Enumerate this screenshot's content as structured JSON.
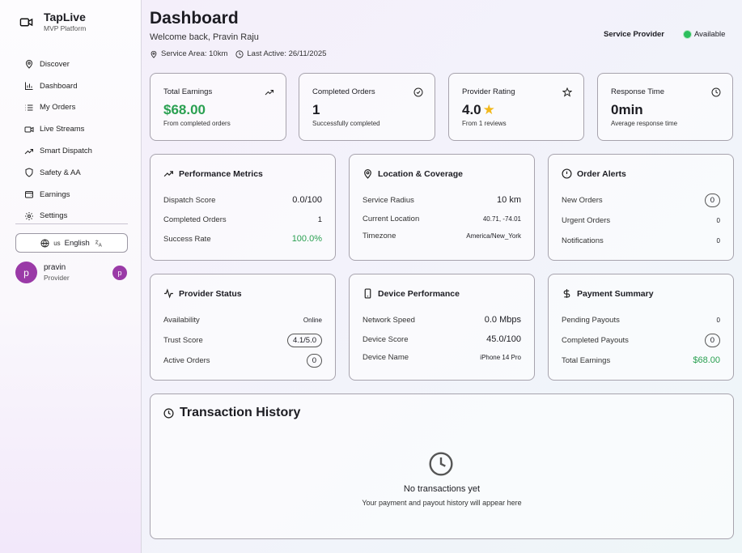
{
  "brand": {
    "name": "TapLive",
    "subtitle": "MVP Platform"
  },
  "nav": [
    {
      "label": "Discover",
      "icon": "map-pin-icon"
    },
    {
      "label": "Dashboard",
      "icon": "bar-chart-icon"
    },
    {
      "label": "My Orders",
      "icon": "list-icon"
    },
    {
      "label": "Live Streams",
      "icon": "video-icon"
    },
    {
      "label": "Smart Dispatch",
      "icon": "trending-up-icon"
    },
    {
      "label": "Safety & AA",
      "icon": "shield-icon"
    },
    {
      "label": "Earnings",
      "icon": "wallet-icon"
    },
    {
      "label": "Settings",
      "icon": "gear-icon"
    }
  ],
  "language": {
    "flag": "us",
    "label": "English"
  },
  "user": {
    "initial": "p",
    "name": "pravin",
    "role": "Provider"
  },
  "header": {
    "title": "Dashboard",
    "welcome": "Welcome back, Pravin Raju",
    "service_area": "Service Area: 10km",
    "last_active": "Last Active: 26/11/2025",
    "role_label": "Service Provider",
    "availability": "Available"
  },
  "stats": [
    {
      "title": "Total Earnings",
      "value": "$68.00",
      "sub": "From completed orders",
      "icon": "trending-up-icon"
    },
    {
      "title": "Completed Orders",
      "value": "1",
      "sub": "Successfully completed",
      "icon": "check-circle-icon"
    },
    {
      "title": "Provider Rating",
      "value": "4.0",
      "sub": "From 1 reviews",
      "icon": "star-icon"
    },
    {
      "title": "Response Time",
      "value": "0min",
      "sub": "Average response time",
      "icon": "clock-icon"
    }
  ],
  "performance": {
    "title": "Performance Metrics",
    "rows": [
      {
        "k": "Dispatch Score",
        "v": "0.0/100"
      },
      {
        "k": "Completed Orders",
        "v": "1"
      },
      {
        "k": "Success Rate",
        "v": "100.0%"
      }
    ]
  },
  "location": {
    "title": "Location & Coverage",
    "rows": [
      {
        "k": "Service Radius",
        "v": "10 km"
      },
      {
        "k": "Current Location",
        "v": "40.71, -74.01"
      },
      {
        "k": "Timezone",
        "v": "America/New_York"
      }
    ]
  },
  "alerts": {
    "title": "Order Alerts",
    "rows": [
      {
        "k": "New Orders",
        "v": "0"
      },
      {
        "k": "Urgent Orders",
        "v": "0"
      },
      {
        "k": "Notifications",
        "v": "0"
      }
    ]
  },
  "provider_status": {
    "title": "Provider Status",
    "rows": [
      {
        "k": "Availability",
        "v": "Online"
      },
      {
        "k": "Trust Score",
        "v": "4.1/5.0"
      },
      {
        "k": "Active Orders",
        "v": "0"
      }
    ]
  },
  "device": {
    "title": "Device Performance",
    "rows": [
      {
        "k": "Network Speed",
        "v": "0.0 Mbps"
      },
      {
        "k": "Device Score",
        "v": "45.0/100"
      },
      {
        "k": "Device Name",
        "v": "iPhone 14 Pro"
      }
    ]
  },
  "payment": {
    "title": "Payment Summary",
    "rows": [
      {
        "k": "Pending Payouts",
        "v": "0"
      },
      {
        "k": "Completed Payouts",
        "v": "0"
      },
      {
        "k": "Total Earnings",
        "v": "$68.00"
      }
    ]
  },
  "transactions": {
    "title": "Transaction History",
    "empty_title": "No transactions yet",
    "empty_note": "Your payment and payout history will appear here"
  },
  "colors": {
    "accent_green": "#2aa051",
    "avatar_purple": "#9a3aa7",
    "status_dot": "#2cbf5d"
  }
}
